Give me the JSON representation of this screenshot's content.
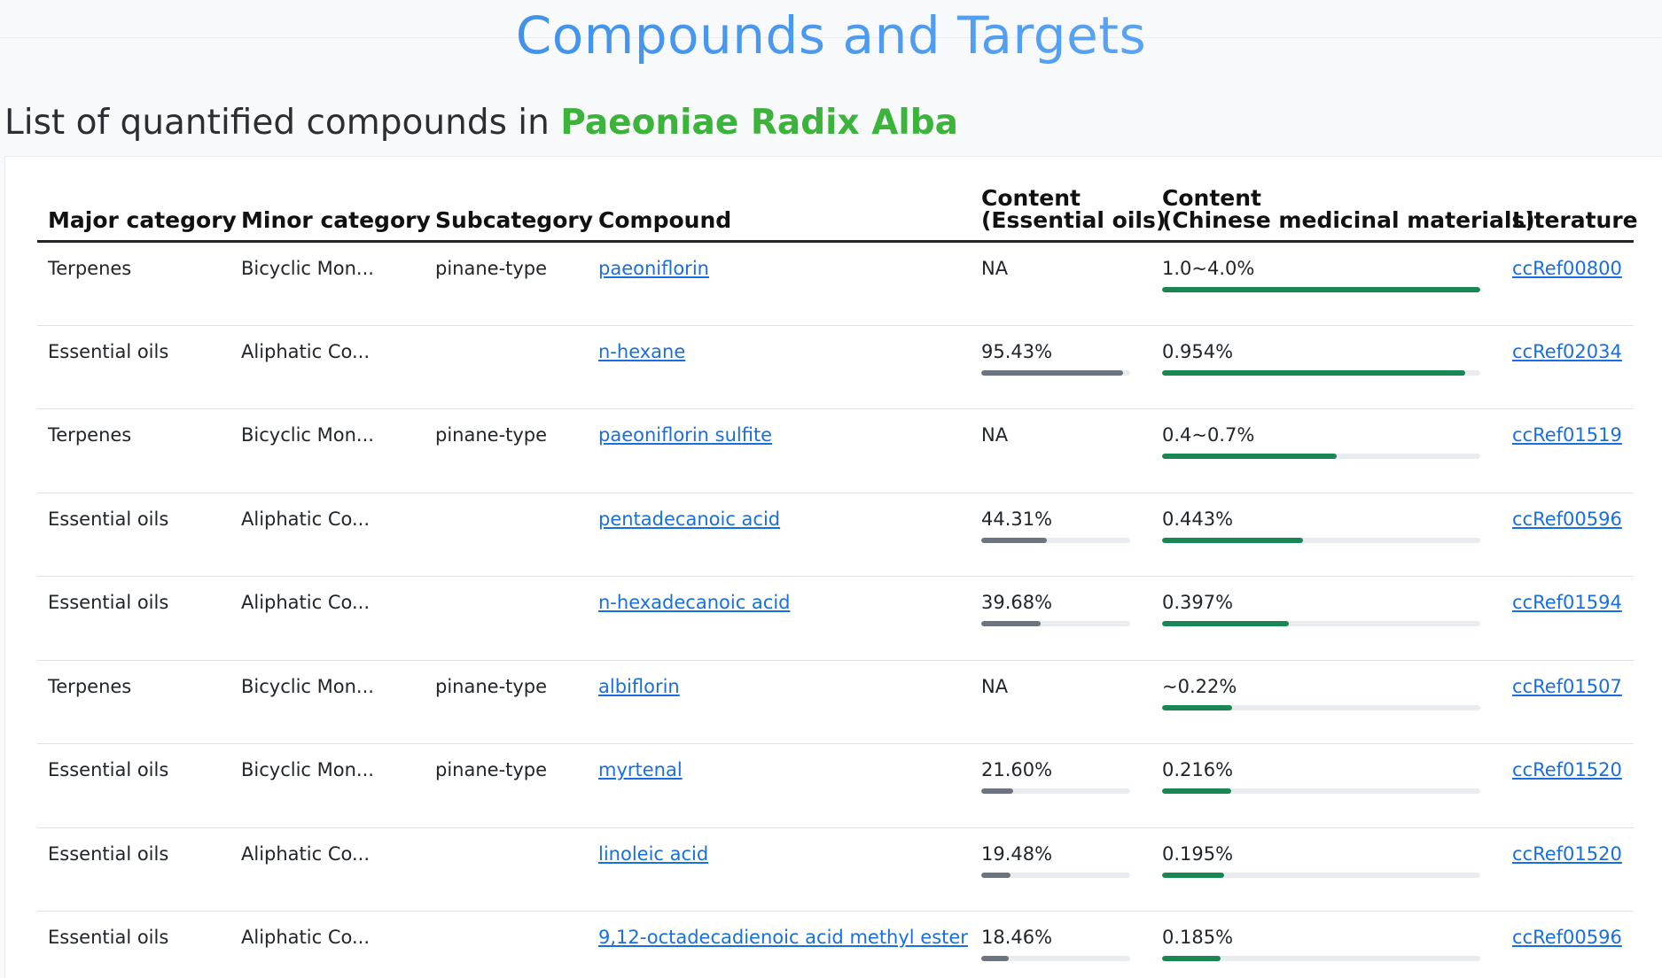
{
  "page": {
    "title": "Compounds and Targets",
    "subheading_prefix": "List of quantified compounds in ",
    "herb": "Paeoniae Radix Alba"
  },
  "colors": {
    "title_gradient_start": "#2e86e4",
    "herb_green": "#3cb43c",
    "link_blue": "#1a6fe0",
    "bar_gray": "#6c757d",
    "bar_green": "#198754"
  },
  "table": {
    "headers": {
      "major": "Major category",
      "minor": "Minor category",
      "sub": "Subcategory",
      "compound": "Compound",
      "eo_line1": "Content",
      "eo_line2": "(Essential oils)",
      "cmm_line1": "Content",
      "cmm_line2": "(Chinese medicinal materials)",
      "literature": "Literature"
    },
    "rows": [
      {
        "major": "Terpenes",
        "minor": "Bicyclic Mon...",
        "sub": "pinane-type",
        "compound": "paeoniflorin",
        "eo": "NA",
        "eo_fill": null,
        "cmm": "1.0~4.0%",
        "cmm_fill": 1.0,
        "ref": "ccRef00800"
      },
      {
        "major": "Essential oils",
        "minor": "Aliphatic Co...",
        "sub": "",
        "compound": "n-hexane",
        "eo": "95.43%",
        "eo_fill": 0.9543,
        "cmm": "0.954%",
        "cmm_fill": 0.954,
        "ref": "ccRef02034"
      },
      {
        "major": "Terpenes",
        "minor": "Bicyclic Mon...",
        "sub": "pinane-type",
        "compound": "paeoniflorin sulfite",
        "eo": "NA",
        "eo_fill": null,
        "cmm": "0.4~0.7%",
        "cmm_fill": 0.55,
        "ref": "ccRef01519"
      },
      {
        "major": "Essential oils",
        "minor": "Aliphatic Co...",
        "sub": "",
        "compound": "pentadecanoic acid",
        "eo": "44.31%",
        "eo_fill": 0.4431,
        "cmm": "0.443%",
        "cmm_fill": 0.443,
        "ref": "ccRef00596"
      },
      {
        "major": "Essential oils",
        "minor": "Aliphatic Co...",
        "sub": "",
        "compound": "n-hexadecanoic acid",
        "eo": "39.68%",
        "eo_fill": 0.3968,
        "cmm": "0.397%",
        "cmm_fill": 0.397,
        "ref": "ccRef01594"
      },
      {
        "major": "Terpenes",
        "minor": "Bicyclic Mon...",
        "sub": "pinane-type",
        "compound": "albiflorin",
        "eo": "NA",
        "eo_fill": null,
        "cmm": "~0.22%",
        "cmm_fill": 0.22,
        "ref": "ccRef01507"
      },
      {
        "major": "Essential oils",
        "minor": "Bicyclic Mon...",
        "sub": "pinane-type",
        "compound": "myrtenal",
        "eo": "21.60%",
        "eo_fill": 0.216,
        "cmm": "0.216%",
        "cmm_fill": 0.216,
        "ref": "ccRef01520"
      },
      {
        "major": "Essential oils",
        "minor": "Aliphatic Co...",
        "sub": "",
        "compound": "linoleic acid",
        "eo": "19.48%",
        "eo_fill": 0.1948,
        "cmm": "0.195%",
        "cmm_fill": 0.195,
        "ref": "ccRef01520"
      },
      {
        "major": "Essential oils",
        "minor": "Aliphatic Co...",
        "sub": "",
        "compound": "9,12-octadecadienoic acid methyl ester",
        "eo": "18.46%",
        "eo_fill": 0.1846,
        "cmm": "0.185%",
        "cmm_fill": 0.185,
        "ref": "ccRef00596"
      }
    ]
  }
}
